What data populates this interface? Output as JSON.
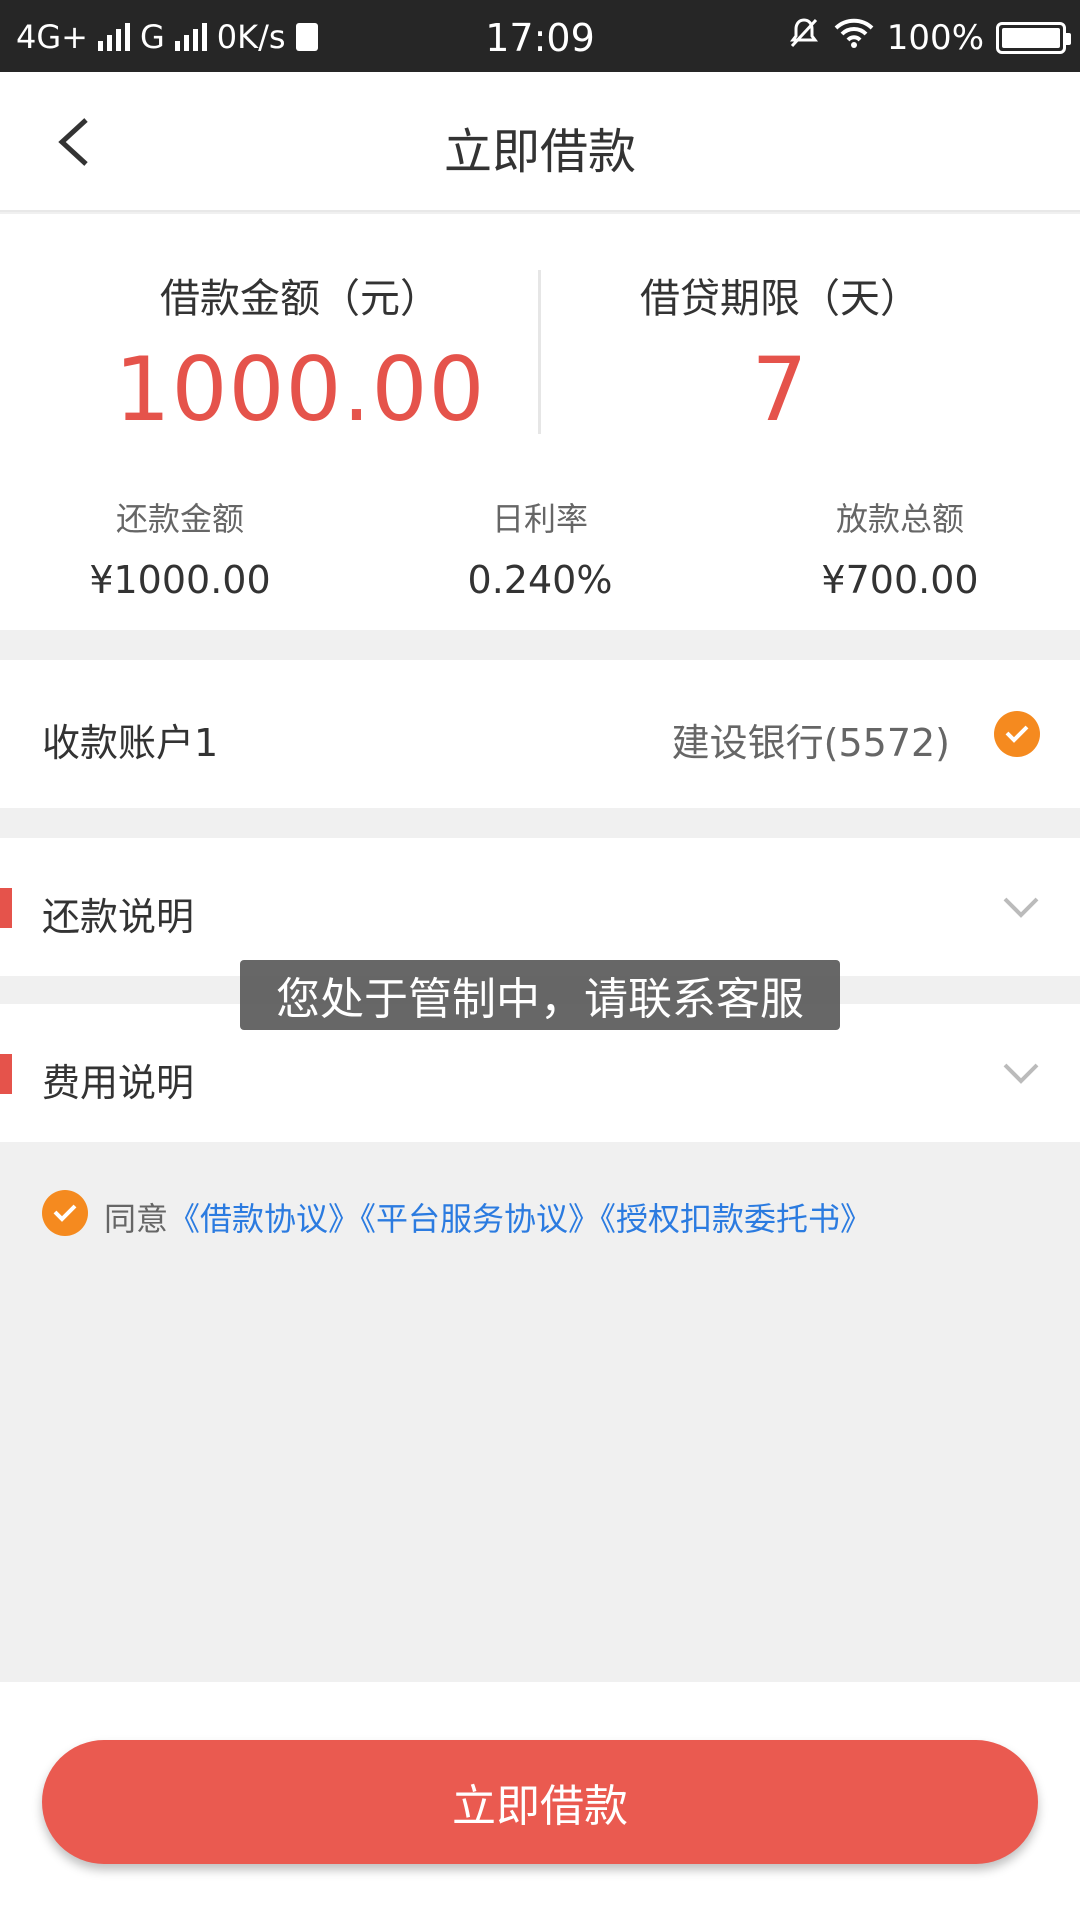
{
  "status_bar": {
    "network1": "4G+",
    "network2": "G",
    "speed": "0K/s",
    "time": "17:09",
    "battery": "100%"
  },
  "nav": {
    "title": "立即借款"
  },
  "summary": {
    "amount_label": "借款金额（元）",
    "amount_value": "1000.00",
    "term_label": "借贷期限（天）",
    "term_value": "7",
    "repay_label": "还款金额",
    "repay_value": "¥1000.00",
    "rate_label": "日利率",
    "rate_value": "0.240%",
    "disburse_label": "放款总额",
    "disburse_value": "¥700.00"
  },
  "account": {
    "label": "收款账户1",
    "bank": "建设银行(5572)"
  },
  "sections": {
    "repay_info": "还款说明",
    "fee_info": "费用说明"
  },
  "toast": "您处于管制中，请联系客服",
  "agreement": {
    "prefix": "同意",
    "link1": "《借款协议》",
    "link2": "《平台服务协议》",
    "link3": "《授权扣款委托书》"
  },
  "submit_label": "立即借款",
  "colors": {
    "accent_red": "#e5534b",
    "check_orange": "#f58a1f",
    "link_blue": "#2b7be0"
  }
}
